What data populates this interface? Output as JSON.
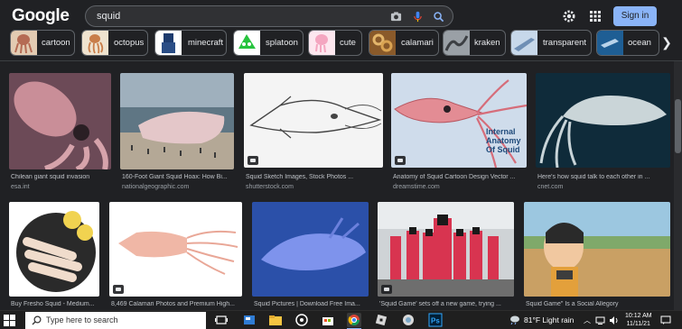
{
  "header": {
    "logo": "Google",
    "query": "squid",
    "signin_label": "Sign in"
  },
  "chips": [
    {
      "label": "cartoon",
      "color": "#c89378"
    },
    {
      "label": "octopus",
      "color": "#d7a76f"
    },
    {
      "label": "minecraft",
      "color": "#3a5fa0"
    },
    {
      "label": "splatoon",
      "color": "#35c24d"
    },
    {
      "label": "cute",
      "color": "#f0a8c3"
    },
    {
      "label": "calamari",
      "color": "#c89a5a"
    },
    {
      "label": "kraken",
      "color": "#777b82"
    },
    {
      "label": "transparent",
      "color": "#5e7fa6"
    },
    {
      "label": "ocean",
      "color": "#2d6fa3"
    }
  ],
  "row1": [
    {
      "title": "Chilean giant squid invasion",
      "source": "esa.int"
    },
    {
      "title": "160-Foot Giant Squid Hoax: How Bi...",
      "source": "nationalgeographic.com"
    },
    {
      "title": "Squid Sketch Images, Stock Photos ...",
      "source": "shutterstock.com"
    },
    {
      "title": "Anatomy of Squid Cartoon Design Vector ...",
      "source": "dreamstime.com",
      "overlay": "Internal Anatomy Of Squid"
    },
    {
      "title": "Here's how squid talk to each other in ...",
      "source": "cnet.com"
    }
  ],
  "row2": [
    {
      "title": "Buy Fresho Squid - Medium..."
    },
    {
      "title": "8,469 Calamari Photos and Premium High..."
    },
    {
      "title": "Squid Pictures | Download Free Ima..."
    },
    {
      "title": "'Squid Game' sets off a new game, trying ..."
    },
    {
      "title": "Squid Game\" Is a Social Allegory"
    }
  ],
  "taskbar": {
    "search_placeholder": "Type here to search",
    "weather": "81°F  Light rain",
    "time": "10:12 AM",
    "date": "11/11/21"
  }
}
